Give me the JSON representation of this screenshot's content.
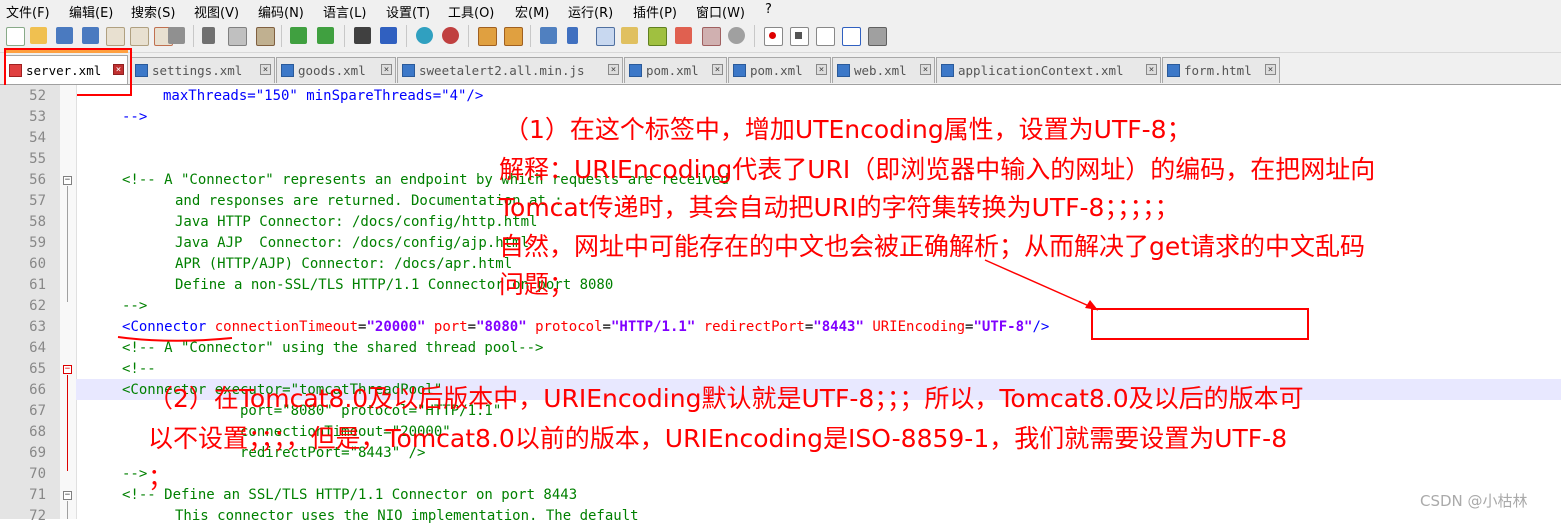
{
  "menu": [
    "文件(F)",
    "编辑(E)",
    "搜索(S)",
    "视图(V)",
    "编码(N)",
    "语言(L)",
    "设置(T)",
    "工具(O)",
    "宏(M)",
    "运行(R)",
    "插件(P)",
    "窗口(W)",
    "?"
  ],
  "tabs": [
    {
      "label": "server.xml",
      "active": true
    },
    {
      "label": "settings.xml"
    },
    {
      "label": "goods.xml"
    },
    {
      "label": "sweetalert2.all.min.js"
    },
    {
      "label": "pom.xml"
    },
    {
      "label": "pom.xml"
    },
    {
      "label": "web.xml"
    },
    {
      "label": "applicationContext.xml"
    },
    {
      "label": "form.html"
    }
  ],
  "tab_close": "×",
  "line_numbers": [
    "52",
    "53",
    "54",
    "55",
    "56",
    "57",
    "58",
    "59",
    "60",
    "61",
    "62",
    "63",
    "64",
    "65",
    "66",
    "67",
    "68",
    "69",
    "70",
    "71",
    "72"
  ],
  "code": {
    "l52": "maxThreads=\"150\" minSpareThreads=\"4\"/>",
    "l53": "-->",
    "l56": "<!-- A \"Connector\" represents an endpoint by which requests are received",
    "l57": "and responses are returned. Documentation at :",
    "l58": "Java HTTP Connector: /docs/config/http.html",
    "l59": "Java AJP  Connector: /docs/config/ajp.html",
    "l60": "APR (HTTP/AJP) Connector: /docs/apr.html",
    "l61": "Define a non-SSL/TLS HTTP/1.1 Connector on port 8080",
    "l62": "-->",
    "l63_open": "<",
    "l63_tag": "Connector",
    "l63_a1": "connectionTimeout",
    "l63_v1": "\"20000\"",
    "l63_a2": "port",
    "l63_v2": "\"8080\"",
    "l63_a3": "protocol",
    "l63_v3": "\"HTTP/1.1\"",
    "l63_a4": "redirectPort",
    "l63_v4": "\"8443\"",
    "l63_a5": "URIEncoding",
    "l63_v5": "\"UTF-8\"",
    "l63_close": "/>",
    "eq": "=",
    "l64": "<!-- A \"Connector\" using the shared thread pool-->",
    "l65": "<!--",
    "l66": "<Connector executor=\"tomcatThreadPool\"",
    "l67": "port=\"8080\" protocol=\"HTTP/1.1\"",
    "l68": "connectionTimeout=\"20000\"",
    "l69": "redirectPort=\"8443\" />",
    "l70": "-->",
    "l71": "<!-- Define an SSL/TLS HTTP/1.1 Connector on port 8443",
    "l72": "This connector uses the NIO implementation. The default"
  },
  "annotations": {
    "a1": "（1）在这个标签中，增加UTEncoding属性，设置为UTF-8；",
    "a2": "解释：URIEncoding代表了URI（即浏览器中输入的网址）的编码，在把网址向",
    "a3": "Tomcat传递时，其会自动把URI的字符集转换为UTF-8；；；；；",
    "a4": "自然，网址中可能存在的中文也会被正确解析；从而解决了get请求的中文乱码",
    "a5": "问题；",
    "b1": "（2）在Tomcat8.0及以后版本中，URIEncoding默认就是UTF-8；；；所以，Tomcat8.0及以后的版本可",
    "b2": "以不设置；；；，但是，Tomcat8.0以前的版本，URIEncoding是ISO-8859-1，我们就需要设置为UTF-8",
    "b3": "；"
  },
  "watermark": "CSDN @小枯林",
  "colors": {
    "annotation": "#ff0000",
    "comment": "#008000",
    "tag": "#0000ff",
    "attr": "#ff0000",
    "value": "#8000ff"
  }
}
